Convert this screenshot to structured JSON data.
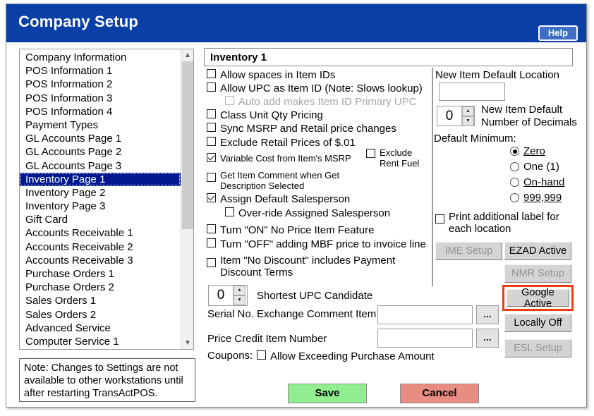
{
  "window": {
    "title": "Company Setup",
    "help_label": "Help"
  },
  "sidebar": {
    "items": [
      {
        "label": "Company Information",
        "selected": false
      },
      {
        "label": "POS Information 1",
        "selected": false
      },
      {
        "label": "POS Information 2",
        "selected": false
      },
      {
        "label": "POS Information 3",
        "selected": false
      },
      {
        "label": "POS Information 4",
        "selected": false
      },
      {
        "label": "Payment Types",
        "selected": false
      },
      {
        "label": "GL Accounts Page 1",
        "selected": false
      },
      {
        "label": "GL Accounts Page 2",
        "selected": false
      },
      {
        "label": "GL Accounts Page 3",
        "selected": false
      },
      {
        "label": "Inventory Page 1",
        "selected": true
      },
      {
        "label": "Inventory Page 2",
        "selected": false
      },
      {
        "label": "Inventory Page 3",
        "selected": false
      },
      {
        "label": "Gift Card",
        "selected": false
      },
      {
        "label": "Accounts Receivable 1",
        "selected": false
      },
      {
        "label": "Accounts Receivable 2",
        "selected": false
      },
      {
        "label": "Accounts Receivable 3",
        "selected": false
      },
      {
        "label": "Purchase Orders 1",
        "selected": false
      },
      {
        "label": "Purchase Orders 2",
        "selected": false
      },
      {
        "label": "Sales Orders 1",
        "selected": false
      },
      {
        "label": "Sales Orders 2",
        "selected": false
      },
      {
        "label": "Advanced Service",
        "selected": false
      },
      {
        "label": "Computer Service 1",
        "selected": false
      }
    ],
    "scroll_up_icon": "chevron-up-icon",
    "scroll_down_icon": "chevron-down-icon"
  },
  "note": {
    "text": "Note: Changes to Settings are not available to other workstations until after restarting TransActPOS."
  },
  "panel": {
    "header": "Inventory 1",
    "checkboxes": {
      "allow_spaces": {
        "label": "Allow spaces in Item IDs",
        "checked": false,
        "disabled": false
      },
      "allow_upc_as_item_id": {
        "label": "Allow UPC as Item ID (Note: Slows lookup)",
        "checked": false,
        "disabled": false
      },
      "auto_add_primary_upc": {
        "label": "Auto add makes Item ID Primary UPC",
        "checked": false,
        "disabled": true
      },
      "class_unit_qty_pricing": {
        "label": "Class Unit Qty Pricing",
        "checked": false,
        "disabled": false
      },
      "sync_msrp_retail": {
        "label": "Sync MSRP and Retail price changes",
        "checked": false,
        "disabled": false
      },
      "exclude_retail_prices": {
        "label": "Exclude Retail Prices of $.01",
        "checked": false,
        "disabled": false
      },
      "variable_cost_msrp": {
        "label": "Variable Cost from Item's MSRP",
        "checked": true,
        "disabled": false
      },
      "exclude_rent_fuel": {
        "label": "Exclude Rent Fuel",
        "checked": false,
        "disabled": false
      },
      "get_item_comment": {
        "label": "Get Item Comment when Get Description Selected",
        "checked": false,
        "disabled": false
      },
      "assign_default_salesperson": {
        "label": "Assign Default Salesperson",
        "checked": true,
        "disabled": false
      },
      "override_assigned_salesperson": {
        "label": "Over-ride Assigned Salesperson",
        "checked": false,
        "disabled": false
      },
      "turn_on_no_price": {
        "label": "Turn \"ON\" No Price Item Feature",
        "checked": false,
        "disabled": false
      },
      "turn_off_mbf": {
        "label": "Turn \"OFF\" adding MBF price to invoice line",
        "checked": false,
        "disabled": false
      },
      "no_discount_payment_terms": {
        "label": "Item \"No Discount\" includes Payment Discount Terms",
        "checked": false,
        "disabled": false
      },
      "allow_exceeding_purchase": {
        "label": "Allow Exceeding Purchase Amount",
        "checked": false,
        "disabled": false
      }
    },
    "shortest_upc": {
      "value": "0",
      "label": "Shortest UPC Candidate",
      "up_icon": "spinner-up-icon",
      "down_icon": "spinner-down-icon"
    },
    "serial_exchange": {
      "label": "Serial No. Exchange Comment Item",
      "value": "",
      "browse_label": "..."
    },
    "price_credit": {
      "label": "Price Credit Item Number",
      "value": "",
      "browse_label": "..."
    },
    "coupons_label": "Coupons:"
  },
  "right_panel": {
    "new_item_default_location": {
      "label": "New Item Default Location",
      "value": ""
    },
    "new_item_decimals": {
      "value": "0",
      "label_line1": "New Item Default",
      "label_line2": "Number of Decimals",
      "up_icon": "spinner-up-icon",
      "down_icon": "spinner-down-icon"
    },
    "default_minimum": {
      "label": "Default Minimum:",
      "options": [
        {
          "label": "Zero",
          "selected": true
        },
        {
          "label": "One (1)",
          "selected": false
        },
        {
          "label": "On-hand",
          "selected": false
        },
        {
          "label": "999,999",
          "selected": false
        }
      ]
    },
    "print_additional_label": {
      "line1": "Print additional label for",
      "line2": "each location",
      "checked": false
    },
    "buttons": [
      {
        "label": "IME Setup",
        "disabled": true
      },
      {
        "label": "EZAD Active",
        "disabled": false
      },
      {
        "label": "NMR Setup",
        "disabled": true
      },
      {
        "label": "Google Active",
        "disabled": false,
        "highlighted": true
      },
      {
        "label": "Locally Off",
        "disabled": false
      },
      {
        "label": "ESL Setup",
        "disabled": true
      }
    ],
    "highlight_color": "#f03c11"
  },
  "footer": {
    "save_label": "Save",
    "cancel_label": "Cancel",
    "save_color": "#90ee90",
    "cancel_color": "#e98c82"
  }
}
